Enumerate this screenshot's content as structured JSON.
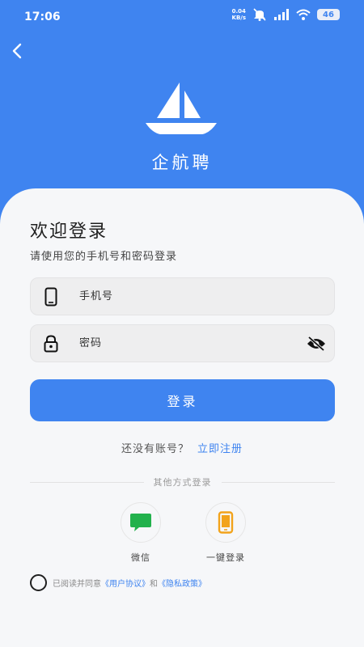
{
  "status_bar": {
    "time": "17:06",
    "net_speed_value": "0.04",
    "net_speed_unit": "KB/s",
    "battery": "46",
    "icons": [
      "mute-icon",
      "signal-icon",
      "wifi-icon",
      "battery-icon"
    ]
  },
  "header": {
    "app_name": "企航聘",
    "logo_icon": "sailboat-icon",
    "background_color": "#3f84f0"
  },
  "login": {
    "title": "欢迎登录",
    "subtitle": "请使用您的手机号和密码登录",
    "phone_placeholder": "手机号",
    "password_placeholder": "密码",
    "login_button": "登录",
    "no_account_text": "还没有账号？",
    "register_link": "立即注册",
    "other_methods": "其他方式登录",
    "options": [
      {
        "label": "微信",
        "icon": "wechat-icon",
        "color": "#22b14c"
      },
      {
        "label": "一键登录",
        "icon": "phone-icon",
        "color": "#f2a31b"
      }
    ],
    "agreement": {
      "prefix": "已阅读并同意",
      "user_agreement": "《用户协议》",
      "and": "和",
      "privacy_policy": "《隐私政策》"
    }
  }
}
